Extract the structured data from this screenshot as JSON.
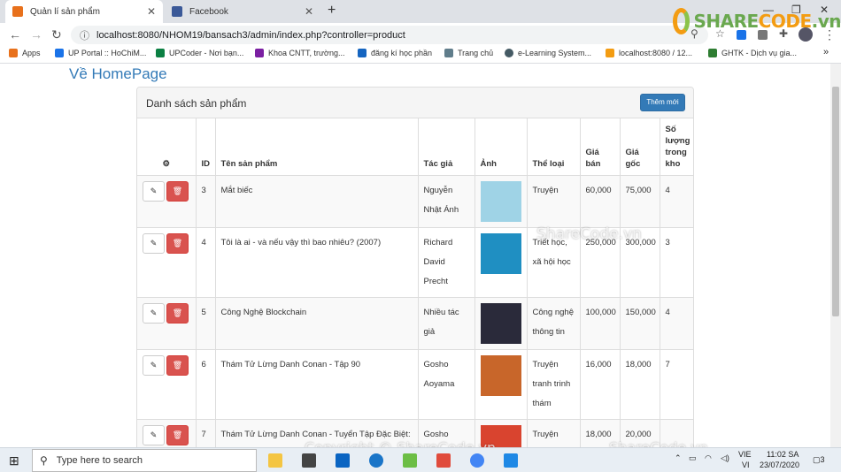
{
  "browser": {
    "tabs": [
      {
        "title": "Quản lí sản phẩm",
        "favicon_color": "#e8711c"
      },
      {
        "title": "Facebook",
        "favicon_color": "#3b5998"
      }
    ],
    "new_tab_symbol": "+",
    "url": "localhost:8080/NHOM19/bansach3/admin/index.php?controller=product",
    "bookmarks": [
      {
        "label": "Apps",
        "color": "#e8711c"
      },
      {
        "label": "UP Portal :: HoChiM...",
        "color": "#1a73e8"
      },
      {
        "label": "UPCoder - Nơi bạn...",
        "color": "#0b8043"
      },
      {
        "label": "Khoa CNTT, trường...",
        "color": "#7b1fa2"
      },
      {
        "label": "đăng kí học phần",
        "color": "#1565c0"
      },
      {
        "label": "Trang chủ",
        "color": "#607d8b"
      },
      {
        "label": "e-Learning System...",
        "color": "#455a64"
      },
      {
        "label": "localhost:8080 / 12...",
        "color": "#f39c12"
      },
      {
        "label": "GHTK - Dịch vụ gia...",
        "color": "#2e7d32"
      }
    ],
    "more_bookmarks": "»"
  },
  "logo": {
    "text_green": "SHARE",
    "text_orange": "CODE",
    "suffix": ".vn"
  },
  "page": {
    "home_link": "Về HomePage",
    "panel_title": "Danh sách sản phẩm",
    "add_button": "Thêm mới",
    "columns": [
      "ID",
      "Tên sản phẩm",
      "Tác giả",
      "Ảnh",
      "Thể loại",
      "Giá bán",
      "Giá gốc",
      "Số lượng trong kho"
    ],
    "gear_icon": "⚙",
    "edit_icon": "✎",
    "delete_icon": "🗑",
    "rows": [
      {
        "id": "3",
        "name": "Mắt biếc",
        "author": "Nguyễn Nhật Ánh",
        "category": "Truyện",
        "price": "60,000",
        "original": "75,000",
        "stock": "4",
        "thumb_color": "#9fd3e6"
      },
      {
        "id": "4",
        "name": "Tôi là ai - và nếu vậy thì bao nhiêu? (2007)",
        "author": "Richard David Precht",
        "category": "Triết học, xã hội học",
        "price": "250,000",
        "original": "300,000",
        "stock": "3",
        "thumb_color": "#1f8fc2"
      },
      {
        "id": "5",
        "name": "Công Nghệ Blockchain",
        "author": "Nhiều tác giả",
        "category": "Công nghệ thông tin",
        "price": "100,000",
        "original": "150,000",
        "stock": "4",
        "thumb_color": "#2a2a3a"
      },
      {
        "id": "6",
        "name": "Thám Tử Lừng Danh Conan - Tập 90",
        "author": "Gosho Aoyama",
        "category": "Truyện tranh trinh thám",
        "price": "16,000",
        "original": "18,000",
        "stock": "7",
        "thumb_color": "#c8662a"
      },
      {
        "id": "7",
        "name": "Thám Tử Lừng Danh Conan - Tuyển Tập Đặc Biệt: Những Câu Chuyện Lãng Mạn",
        "author": "Gosho",
        "category": "Truyện tranh trinh",
        "price": "18,000",
        "original": "20,000",
        "stock": "",
        "thumb_color": "#d9442f"
      }
    ]
  },
  "watermarks": [
    "ShareCode.vn",
    "Copyright © ShareCode.vn",
    "ShareCode.vn"
  ],
  "taskbar": {
    "search_placeholder": "Type here to search",
    "lang_1": "VIE",
    "lang_2": "VI",
    "time": "11:02 SA",
    "date": "23/07/2020",
    "notifications": "3"
  }
}
